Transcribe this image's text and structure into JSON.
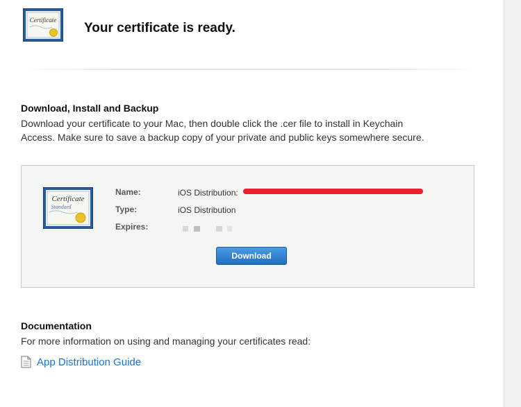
{
  "header": {
    "title": "Your certificate is ready."
  },
  "download_section": {
    "heading": "Download, Install and Backup",
    "text_line1": "Download your certificate to your Mac, then double click the .cer file to install in Keychain",
    "text_line2": "Access. Make sure to save a backup copy of your private and public keys somewhere secure."
  },
  "certificate": {
    "icon_text": "Certificate",
    "icon_subtext": "Standard",
    "name_label": "Name:",
    "name_value": "iOS Distribution:",
    "type_label": "Type:",
    "type_value": "iOS Distribution",
    "expires_label": "Expires:",
    "download_label": "Download"
  },
  "documentation": {
    "heading": "Documentation",
    "text": "For more information on using and managing your certificates read:",
    "link_label": "App Distribution Guide"
  },
  "colors": {
    "link": "#1a73c9",
    "button": "#2a7fd4",
    "redaction": "#e8232e"
  },
  "icons": {
    "certificate": "certificate-icon",
    "document": "document-icon"
  }
}
